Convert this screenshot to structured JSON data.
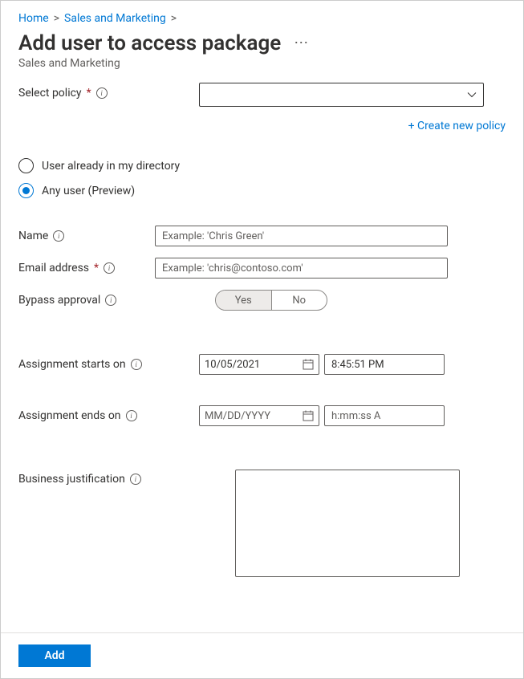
{
  "breadcrumb": {
    "home": "Home",
    "level2": "Sales and Marketing"
  },
  "page": {
    "title": "Add user to access package",
    "subtitle": "Sales and Marketing"
  },
  "policy": {
    "label": "Select policy",
    "create_link": "+ Create new policy"
  },
  "user_type": {
    "opt_directory": "User already in my directory",
    "opt_any": "Any user (Preview)",
    "selected": "any"
  },
  "fields": {
    "name": {
      "label": "Name",
      "placeholder": "Example: 'Chris Green'",
      "value": ""
    },
    "email": {
      "label": "Email address",
      "placeholder": "Example: 'chris@contoso.com'",
      "value": ""
    },
    "bypass": {
      "label": "Bypass approval",
      "yes": "Yes",
      "no": "No",
      "selected": "yes"
    },
    "starts": {
      "label": "Assignment starts on",
      "date": "10/05/2021",
      "time": "8:45:51 PM"
    },
    "ends": {
      "label": "Assignment ends on",
      "date_placeholder": "MM/DD/YYYY",
      "time_placeholder": "h:mm:ss A"
    },
    "justification": {
      "label": "Business justification",
      "value": ""
    }
  },
  "footer": {
    "add": "Add"
  }
}
